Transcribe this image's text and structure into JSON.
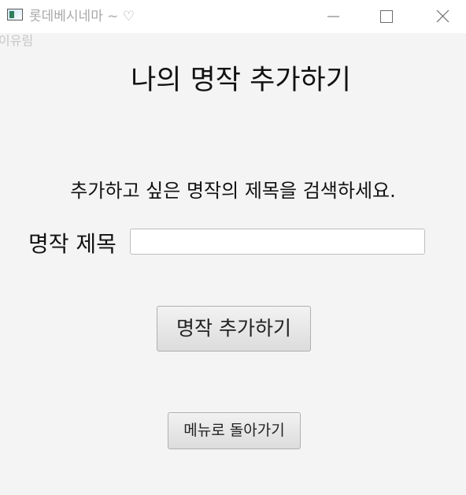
{
  "window": {
    "title": "롯데베시네마 ~ ♡"
  },
  "overlay_label": "이유림",
  "page": {
    "heading": "나의 명작 추가하기",
    "instruction": "추가하고 싶은 명작의 제목을 검색하세요.",
    "field_label": "명작 제목",
    "input_value": "",
    "add_button_label": "명작 추가하기",
    "back_button_label": "메뉴로 돌아가기"
  },
  "colors": {
    "background": "#f4f4f4",
    "titlebar": "#ffffff",
    "title_text": "#a9a9a9",
    "button_border": "#b0b0b0"
  },
  "icons": {
    "app": "app-window-icon",
    "minimize": "minimize-icon",
    "maximize": "maximize-icon",
    "close": "close-icon"
  }
}
